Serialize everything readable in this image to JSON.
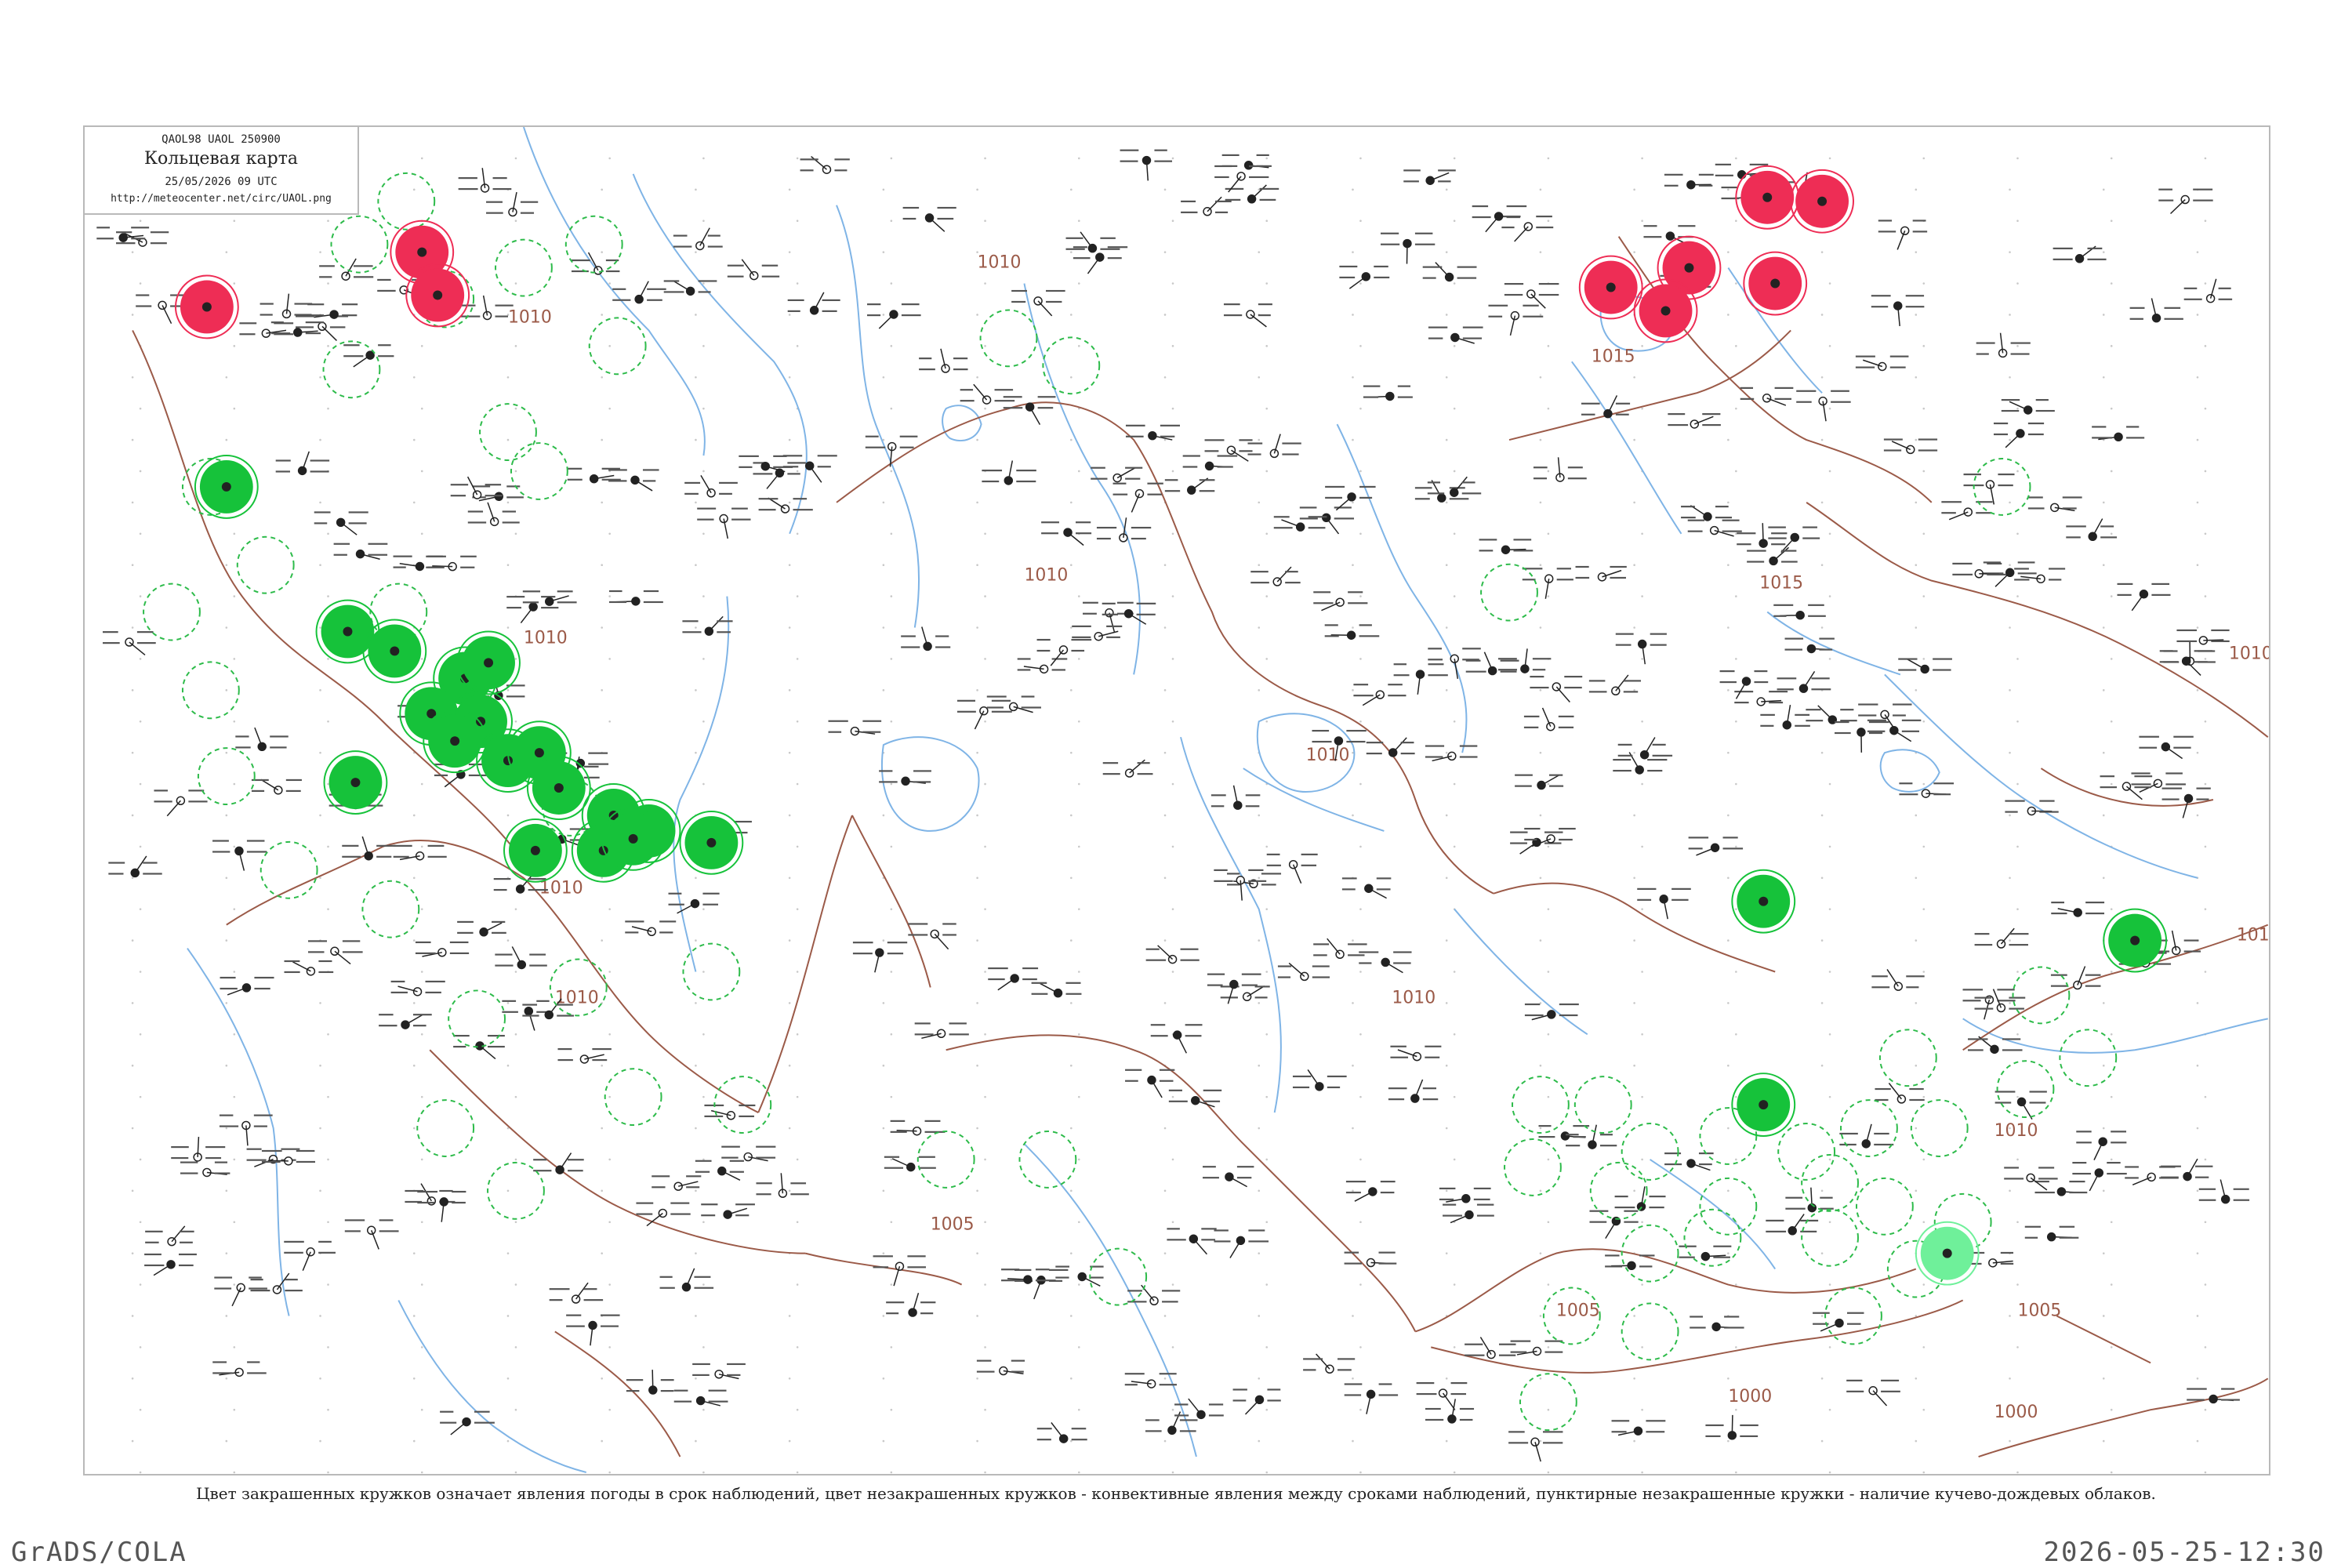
{
  "header": {
    "code": "QAOL98  UAOL  250900",
    "title": "Кольцевая карта",
    "time": "25/05/2026 09 UTC",
    "url": "http://meteocenter.net/circ/UAOL.png"
  },
  "caption": "Цвет закрашенных кружков означает явления погоды в срок наблюдений, цвет незакрашенных кружков - конвективные явления между сроками наблюдений, пунктирные незакрашенные кружки - наличие кучево-дождевых облаков.",
  "footer": {
    "left": "GrADS/COLA",
    "right": "2026-05-25-12:30"
  },
  "colors": {
    "isobar": "#9b5a48",
    "water": "#7fb4e6",
    "thunder": "#ee2d55",
    "rain": "#16c23a",
    "showers": "#6ff09a",
    "cb_dashed": "#2dbb4a",
    "station": "#222222"
  },
  "isobars": {
    "labels": [
      "1010",
      "1010",
      "1010",
      "1010",
      "1010",
      "1010",
      "1010",
      "1010",
      "1010",
      "1015",
      "1015",
      "1010",
      "1010",
      "1005",
      "1005",
      "1005",
      "1000",
      "1000"
    ]
  },
  "map_features": {
    "thunderstorm_markers": 9,
    "rain_markers": 20,
    "showers_markers": 1
  }
}
